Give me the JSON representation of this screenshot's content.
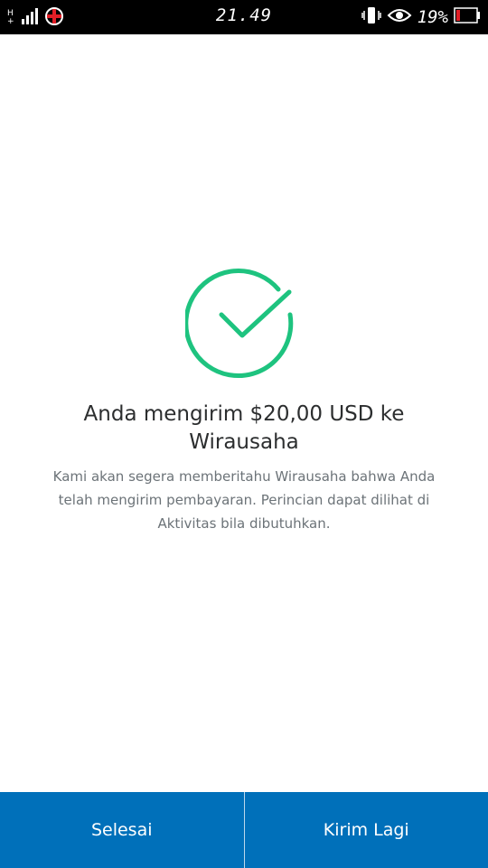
{
  "status_bar": {
    "network_label": "H+",
    "time": "21.49",
    "battery_percent": "19%",
    "battery_level": 0.19
  },
  "success": {
    "icon": "check-circle-icon",
    "accent_color": "#1ec37f",
    "headline": "Anda mengirim $20,00 USD ke Wirausaha",
    "message": "Kami akan segera memberitahu Wirausaha bahwa Anda telah mengirim pembayaran. Perincian dapat dilihat di Aktivitas bila dibutuhkan."
  },
  "actions": {
    "done_label": "Selesai",
    "send_again_label": "Kirim Lagi",
    "bar_color": "#0070ba"
  }
}
